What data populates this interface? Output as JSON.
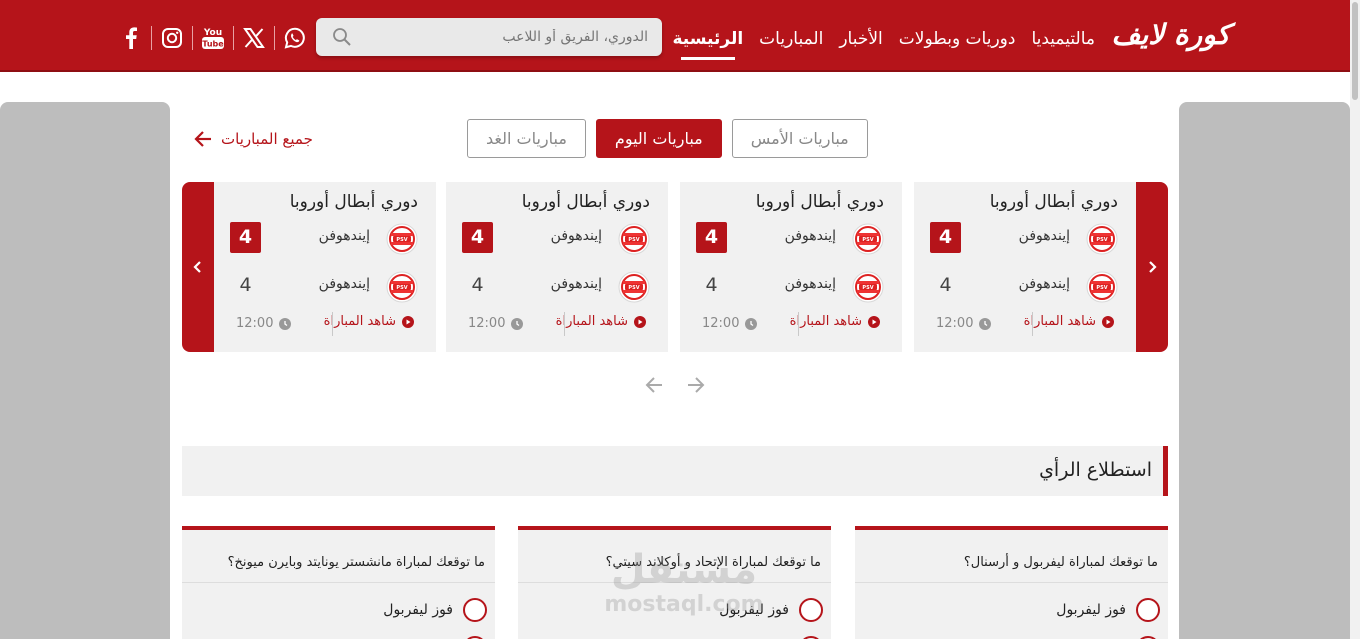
{
  "header": {
    "logo": "كورة لايف",
    "nav": [
      {
        "label": "الرئيسية",
        "active": true
      },
      {
        "label": "المباريات",
        "active": false
      },
      {
        "label": "الأخبار",
        "active": false
      },
      {
        "label": "دوريات وبطولات",
        "active": false
      },
      {
        "label": "مالتيميديا",
        "active": false
      }
    ],
    "search": {
      "placeholder": "الدوري، الفريق أو اللاعب",
      "icon": "search-icon"
    },
    "social": [
      "whatsapp-icon",
      "x-icon",
      "youtube-icon",
      "instagram-icon",
      "facebook-icon"
    ],
    "accent": "#b5141a"
  },
  "matches": {
    "tabs": [
      {
        "label": "مباريات الأمس",
        "active": false
      },
      {
        "label": "مباريات اليوم",
        "active": true
      },
      {
        "label": "مباريات الغد",
        "active": false
      }
    ],
    "all_link": "جميع المباريات",
    "cards": [
      {
        "league": "دوري أبطال أوروبا",
        "home": {
          "name": "إيندهوفن",
          "score": "4"
        },
        "away": {
          "name": "إيندهوفن",
          "score": "4"
        },
        "watch": "شاهد المباراة",
        "time": "12:00"
      },
      {
        "league": "دوري أبطال أوروبا",
        "home": {
          "name": "إيندهوفن",
          "score": "4"
        },
        "away": {
          "name": "إيندهوفن",
          "score": "4"
        },
        "watch": "شاهد المباراة",
        "time": "12:00"
      },
      {
        "league": "دوري أبطال أوروبا",
        "home": {
          "name": "إيندهوفن",
          "score": "4"
        },
        "away": {
          "name": "إيندهوفن",
          "score": "4"
        },
        "watch": "شاهد المباراة",
        "time": "12:00"
      },
      {
        "league": "دوري أبطال أوروبا",
        "home": {
          "name": "إيندهوفن",
          "score": "4"
        },
        "away": {
          "name": "إيندهوفن",
          "score": "4"
        },
        "watch": "شاهد المباراة",
        "time": "12:00"
      }
    ]
  },
  "poll": {
    "title": "استطلاع الرأي",
    "cards": [
      {
        "question": "ما توقعك لمباراة ليفربول و أرسنال؟",
        "option": "فوز ليفربول"
      },
      {
        "question": "ما توقعك لمباراة الإتحاد و أوكلاند سيتي؟",
        "option": "فوز ليفربول"
      },
      {
        "question": "ما توقعك لمباراة مانشستر يونايتد وبايرن ميونخ؟",
        "option": "فوز ليفربول"
      }
    ]
  },
  "watermark": {
    "line1": "مستقل",
    "line2": "mostaql.com"
  }
}
